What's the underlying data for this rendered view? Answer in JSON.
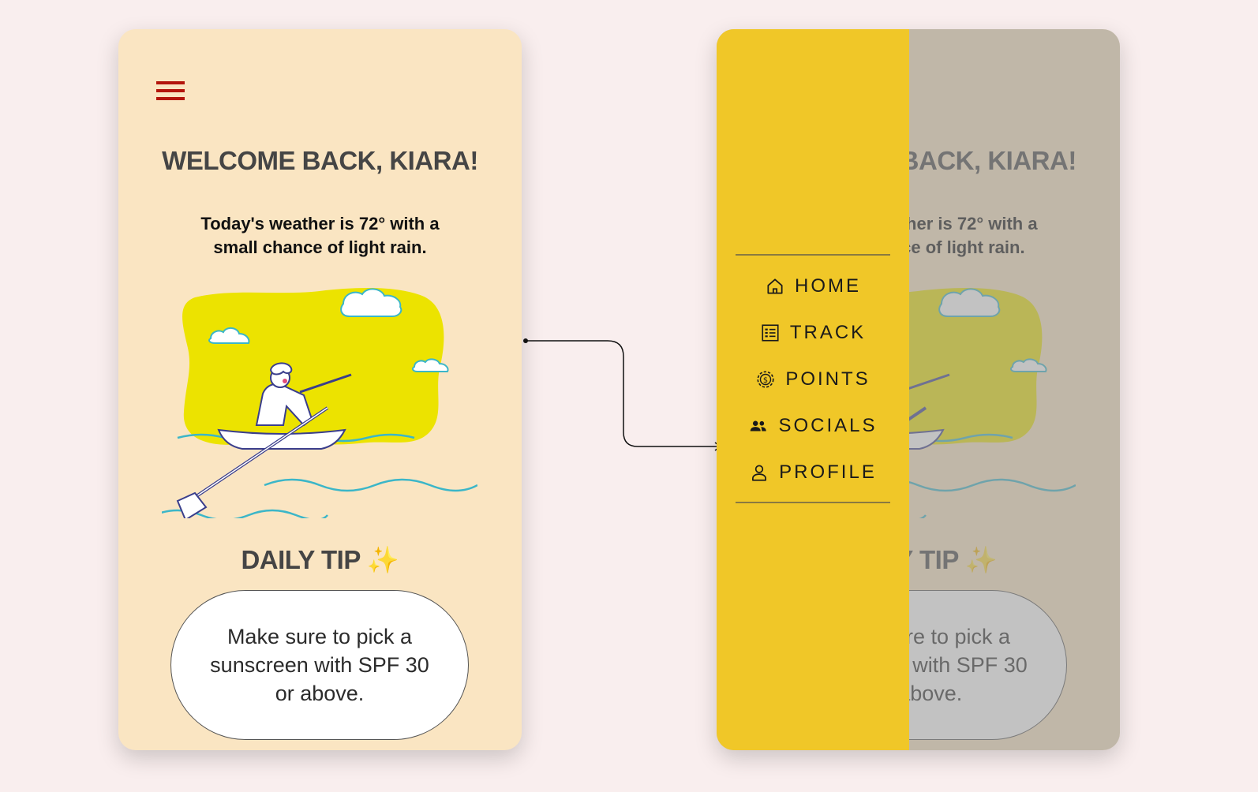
{
  "home": {
    "menu_icon": "hamburger-menu-icon",
    "title": "WELCOME BACK, KIARA!",
    "weather_line1": "Today's weather is 72° with a",
    "weather_line2": "small chance of  light rain.",
    "illustration": "rower-in-boat-illustration",
    "daily_tip_title": "DAILY TIP ✨",
    "daily_tip_text": "Make sure to pick a sunscreen with SPF 30 or above."
  },
  "nav_drawer": {
    "items": [
      {
        "label": "HOME",
        "icon": "home-icon"
      },
      {
        "label": "TRACK",
        "icon": "track-list-icon"
      },
      {
        "label": "POINTS",
        "icon": "coin-points-icon"
      },
      {
        "label": "SOCIALS",
        "icon": "people-icon"
      },
      {
        "label": "PROFILE",
        "icon": "person-icon"
      }
    ]
  },
  "colors": {
    "background": "#f9eeee",
    "screen": "#fae5c2",
    "drawer": "#f0c728",
    "menu_icon": "#b3140b",
    "heading": "#454545"
  }
}
